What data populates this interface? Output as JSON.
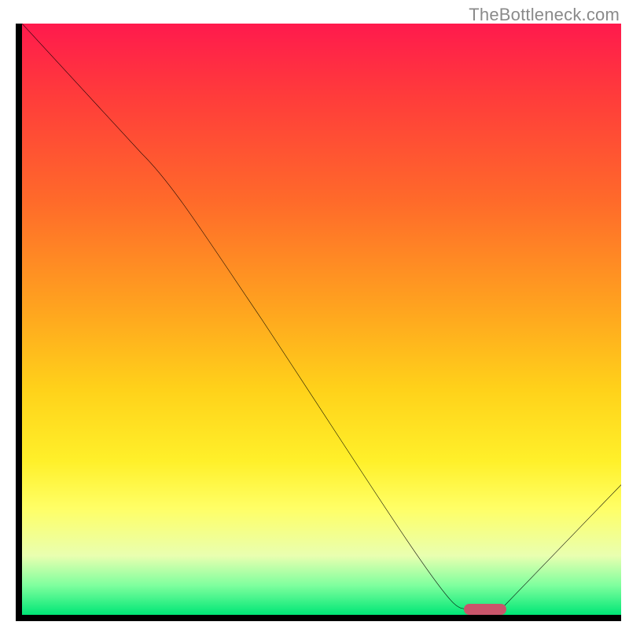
{
  "watermark": "TheBottleneck.com",
  "chart_data": {
    "type": "line",
    "title": "",
    "xlabel": "",
    "ylabel": "",
    "xlim": [
      0,
      100
    ],
    "ylim": [
      0,
      100
    ],
    "grid": false,
    "legend": false,
    "x": [
      0,
      20,
      74,
      80,
      100
    ],
    "values": [
      100,
      78,
      1,
      1,
      22
    ],
    "series_note": "Single black curve; y≈bottleneck %. Drops from 100 at x=0 to a flat minimum near 0 over x≈74–80, then rises to ≈22 at x=100.",
    "optimal_marker": {
      "x_start": 74,
      "x_end": 80,
      "y": 0.5
    },
    "background": {
      "type": "vertical-gradient",
      "stops": [
        {
          "pct": 0,
          "color": "#ff1a4d"
        },
        {
          "pct": 12,
          "color": "#ff3b3b"
        },
        {
          "pct": 30,
          "color": "#ff6a2a"
        },
        {
          "pct": 48,
          "color": "#ffa31f"
        },
        {
          "pct": 62,
          "color": "#ffd21a"
        },
        {
          "pct": 74,
          "color": "#fff02a"
        },
        {
          "pct": 82,
          "color": "#ffff66"
        },
        {
          "pct": 90,
          "color": "#e9ffb0"
        },
        {
          "pct": 95,
          "color": "#7fff9e"
        },
        {
          "pct": 100,
          "color": "#00e676"
        }
      ]
    }
  }
}
